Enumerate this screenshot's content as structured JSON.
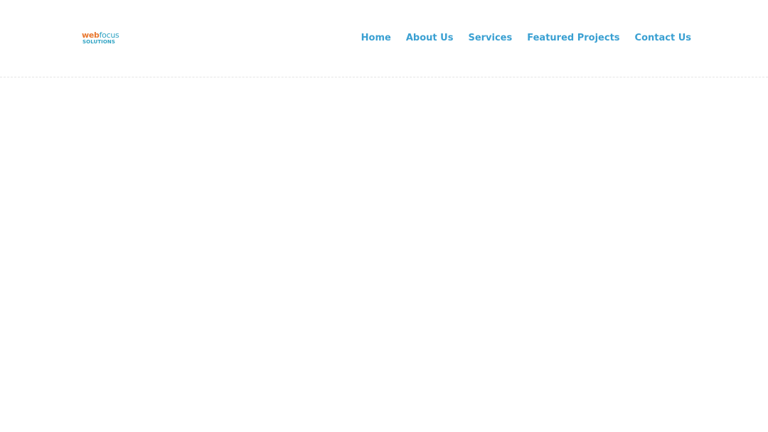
{
  "header": {
    "logo": {
      "word1": "web",
      "word2": "focus",
      "word3": "SOLUTIONS"
    },
    "nav": [
      {
        "label": "Home"
      },
      {
        "label": "About Us"
      },
      {
        "label": "Services"
      },
      {
        "label": "Featured Projects"
      },
      {
        "label": "Contact Us"
      }
    ]
  },
  "colors": {
    "nav_link": "#3aa0d2",
    "logo_orange": "#e8772e",
    "logo_blue": "#2fa3c3",
    "background": "#ffffff"
  }
}
